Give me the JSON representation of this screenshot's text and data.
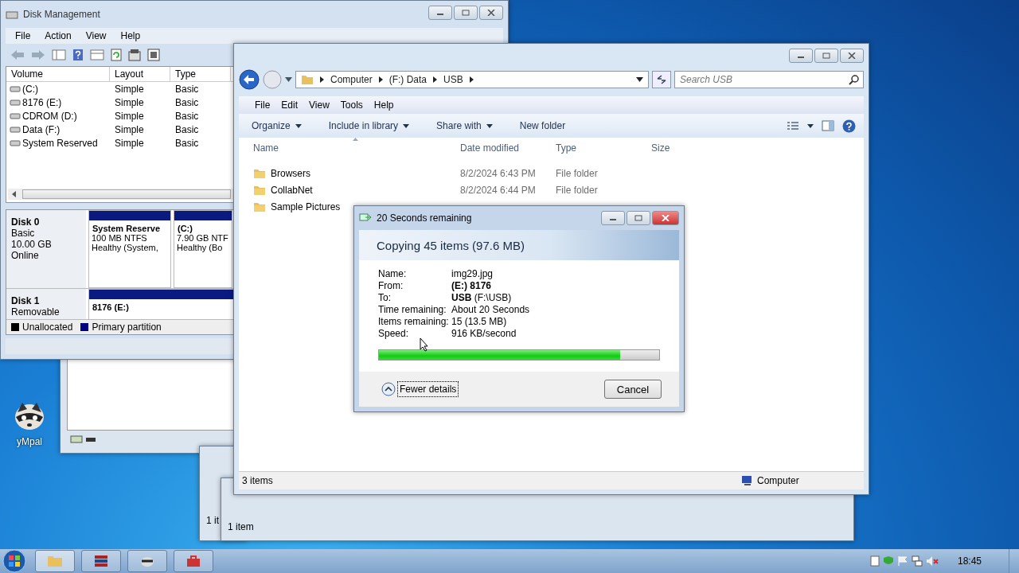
{
  "desktop_icons": [
    {
      "label": "yMpal"
    }
  ],
  "disk_management": {
    "title": "Disk Management",
    "menu": [
      "File",
      "Action",
      "View",
      "Help"
    ],
    "columns": [
      "Volume",
      "Layout",
      "Type"
    ],
    "volumes": [
      {
        "cells": [
          "(C:)",
          "Simple",
          "Basic"
        ]
      },
      {
        "cells": [
          "8176 (E:)",
          "Simple",
          "Basic"
        ]
      },
      {
        "cells": [
          "CDROM (D:)",
          "Simple",
          "Basic"
        ]
      },
      {
        "cells": [
          "Data (F:)",
          "Simple",
          "Basic"
        ]
      },
      {
        "cells": [
          "System Reserved",
          "Simple",
          "Basic"
        ]
      }
    ],
    "disks": [
      {
        "name": "Disk 0",
        "lines": [
          "Basic",
          "10.00 GB",
          "Online"
        ],
        "partitions": [
          {
            "title": "System Reserve",
            "lines": [
              "100 MB NTFS",
              "Healthy (System,"
            ]
          },
          {
            "title": "(C:)",
            "lines": [
              "7.90 GB NTF",
              "Healthy (Bo"
            ]
          }
        ]
      },
      {
        "name": "Disk 1",
        "lines": [
          "Removable"
        ],
        "partitions": [
          {
            "title": "8176  (E:)"
          }
        ]
      }
    ],
    "legend": [
      {
        "label": "Unallocated",
        "color": "#000000"
      },
      {
        "label": "Primary partition",
        "color": "#000080"
      }
    ]
  },
  "background_windows": [
    {
      "status": "1 it"
    },
    {
      "status": "1 item"
    }
  ],
  "explorer": {
    "breadcrumb": [
      "Computer",
      "(F:) Data",
      "USB"
    ],
    "search": {
      "placeholder": "Search USB"
    },
    "menu": [
      "File",
      "Edit",
      "View",
      "Tools",
      "Help"
    ],
    "toolbar": [
      {
        "label": "Organize",
        "dropdown": true
      },
      {
        "label": "Include in library",
        "dropdown": true
      },
      {
        "label": "Share with",
        "dropdown": true
      },
      {
        "label": "New folder",
        "dropdown": false
      }
    ],
    "columns": [
      "Name",
      "Date modified",
      "Type",
      "Size"
    ],
    "rows": [
      {
        "name": "Browsers",
        "date": "8/2/2024 6:43 PM",
        "type": "File folder"
      },
      {
        "name": "CollabNet",
        "date": "8/2/2024 6:44 PM",
        "type": "File folder"
      },
      {
        "name": "Sample Pictures"
      }
    ],
    "status": "3 items",
    "location": "Computer"
  },
  "copy_dialog": {
    "title": "20 Seconds remaining",
    "heading": "Copying 45 items (97.6 MB)",
    "details": [
      {
        "label": "Name:",
        "value": "img29.jpg"
      },
      {
        "label": "From:",
        "value": "**(E:) 8176**"
      },
      {
        "label": "To:",
        "value": "**USB** (F:\\USB)"
      },
      {
        "label": "Time remaining:",
        "value": "About 20 Seconds"
      },
      {
        "label": "Items remaining:",
        "value": "15 (13.5 MB)"
      },
      {
        "label": "Speed:",
        "value": "916 KB/second"
      }
    ],
    "progress": {
      "level": 0.86
    },
    "toggle": "Fewer details",
    "cancel": "Cancel"
  },
  "taskbar": {
    "clock": "18:45"
  }
}
